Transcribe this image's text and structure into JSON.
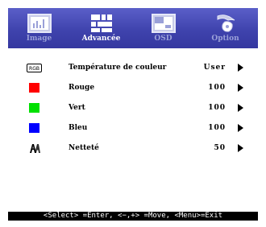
{
  "tabs": [
    {
      "label": "Image",
      "icon": "image-tab-icon",
      "active": false
    },
    {
      "label": "Advancée",
      "icon": "advanced-grid-icon",
      "active": true
    },
    {
      "label": "OSD",
      "icon": "osd-window-icon",
      "active": false
    },
    {
      "label": "Option",
      "icon": "option-hand-icon",
      "active": false
    }
  ],
  "menu": {
    "items": [
      {
        "label": "Température de couleur",
        "value": "User",
        "icon": "rgb-icon"
      },
      {
        "label": "Rouge",
        "value": "100",
        "icon": "red-swatch",
        "color": "#ff0000"
      },
      {
        "label": "Vert",
        "value": "100",
        "icon": "green-swatch",
        "color": "#00e000"
      },
      {
        "label": "Bleu",
        "value": "100",
        "icon": "blue-swatch",
        "color": "#0000ff"
      },
      {
        "label": "Netteté",
        "value": "50",
        "icon": "sharpness-icon"
      }
    ]
  },
  "status_bar": {
    "text": "<Select> =Enter, <−,+> =Move, <Menu>=Exit"
  },
  "colors": {
    "tab_bar": "#4246b0",
    "active_text": "#ffffff",
    "inactive_text": "#9aa0d8",
    "status_bg": "#000000"
  },
  "rgb_icon_text": "RGB"
}
